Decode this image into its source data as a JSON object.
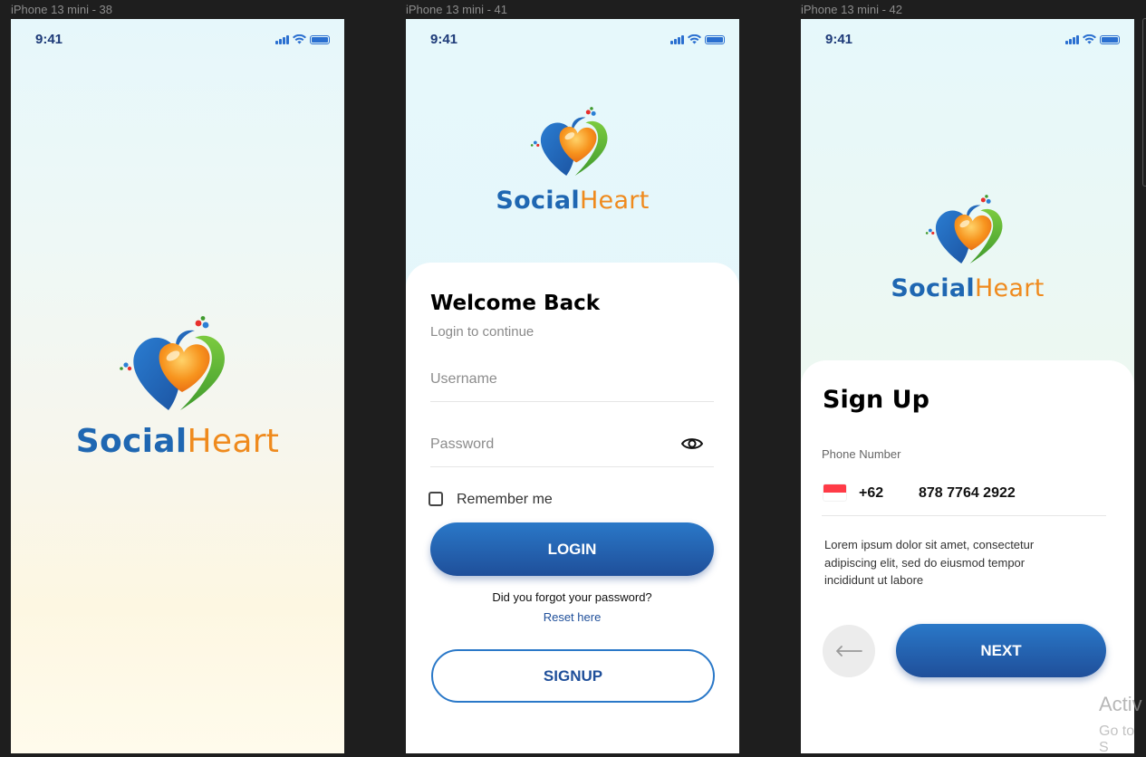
{
  "frames": [
    {
      "label": "iPhone 13 mini - 38"
    },
    {
      "label": "iPhone 13 mini - 41"
    },
    {
      "label": "iPhone 13 mini - 42"
    }
  ],
  "status": {
    "time": "9:41"
  },
  "brand": {
    "part1": "Social",
    "part2": "Heart"
  },
  "login": {
    "title": "Welcome Back",
    "subtitle": "Login to continue",
    "username_placeholder": "Username",
    "password_placeholder": "Password",
    "remember": "Remember me",
    "login_label": "LOGIN",
    "forgot": "Did you forgot your password?",
    "reset": "Reset here",
    "signup_label": "SIGNUP"
  },
  "signup": {
    "title": "Sign Up",
    "phone_label": "Phone Number",
    "dial_code": "+62",
    "phone_value": "878 7764 2922",
    "lorem": "Lorem ipsum dolor sit amet, consectetur adipiscing elit, sed do eiusmod tempor incididunt ut labore",
    "next_label": "NEXT"
  },
  "watermark": {
    "line1": "Activ",
    "line2": "Go to S"
  },
  "icons": {
    "signal": "signal-icon",
    "wifi": "wifi-icon",
    "battery": "battery-icon",
    "eye": "eye-icon",
    "back": "arrow-left-icon",
    "flag": "indonesia-flag-icon"
  },
  "colors": {
    "brand_blue": "#1f67b2",
    "brand_orange": "#ef8a1d",
    "button_top": "#2a78c8",
    "button_bottom": "#1f4f9a",
    "canvas": "#1e1e1e"
  }
}
